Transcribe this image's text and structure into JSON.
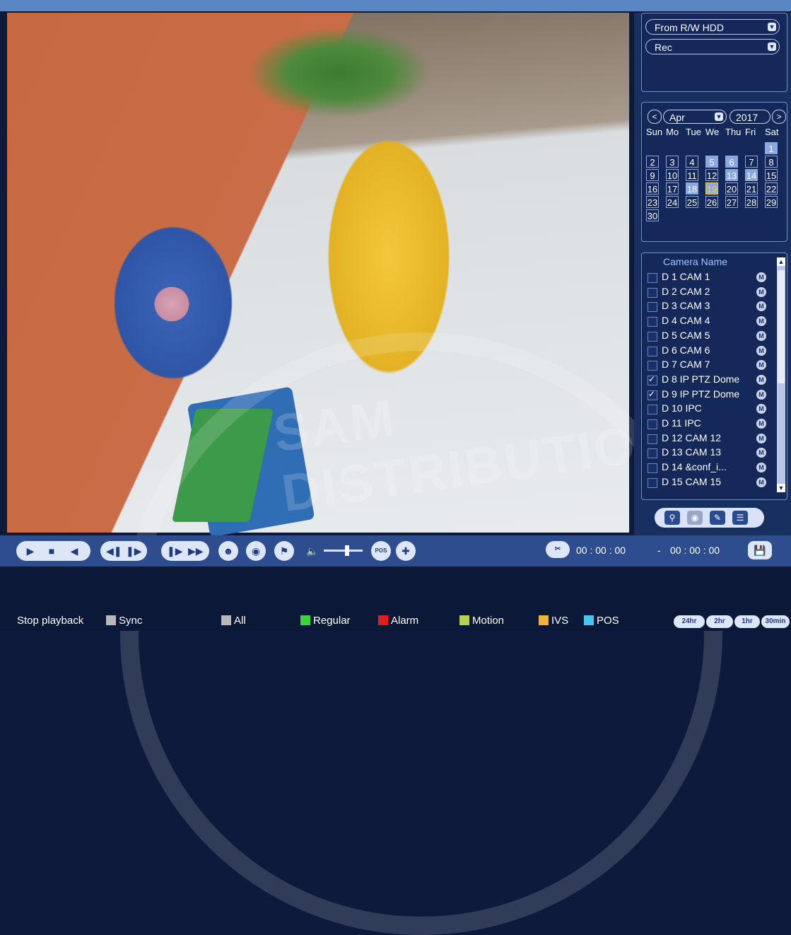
{
  "video": {
    "watermark": "SAM DISTRIBUTION"
  },
  "source": {
    "device": "From R/W HDD",
    "type": "Rec"
  },
  "calendar": {
    "month": "Apr",
    "year": "2017",
    "weekdays": [
      "Sun",
      "Mo",
      "Tue",
      "We",
      "Thu",
      "Fri",
      "Sat"
    ],
    "days": [
      {
        "d": "1",
        "col": 6,
        "row": 0,
        "rec": true
      },
      {
        "d": "2",
        "col": 0,
        "row": 1
      },
      {
        "d": "3",
        "col": 1,
        "row": 1
      },
      {
        "d": "4",
        "col": 2,
        "row": 1
      },
      {
        "d": "5",
        "col": 3,
        "row": 1,
        "rec": true
      },
      {
        "d": "6",
        "col": 4,
        "row": 1,
        "rec": true
      },
      {
        "d": "7",
        "col": 5,
        "row": 1
      },
      {
        "d": "8",
        "col": 6,
        "row": 1
      },
      {
        "d": "9",
        "col": 0,
        "row": 2
      },
      {
        "d": "10",
        "col": 1,
        "row": 2
      },
      {
        "d": "11",
        "col": 2,
        "row": 2
      },
      {
        "d": "12",
        "col": 3,
        "row": 2
      },
      {
        "d": "13",
        "col": 4,
        "row": 2,
        "rec": true
      },
      {
        "d": "14",
        "col": 5,
        "row": 2,
        "rec": true
      },
      {
        "d": "15",
        "col": 6,
        "row": 2
      },
      {
        "d": "16",
        "col": 0,
        "row": 3
      },
      {
        "d": "17",
        "col": 1,
        "row": 3
      },
      {
        "d": "18",
        "col": 2,
        "row": 3,
        "rec": true
      },
      {
        "d": "19",
        "col": 3,
        "row": 3,
        "today": true
      },
      {
        "d": "20",
        "col": 4,
        "row": 3
      },
      {
        "d": "21",
        "col": 5,
        "row": 3
      },
      {
        "d": "22",
        "col": 6,
        "row": 3
      },
      {
        "d": "23",
        "col": 0,
        "row": 4
      },
      {
        "d": "24",
        "col": 1,
        "row": 4
      },
      {
        "d": "25",
        "col": 2,
        "row": 4
      },
      {
        "d": "26",
        "col": 3,
        "row": 4
      },
      {
        "d": "27",
        "col": 4,
        "row": 4
      },
      {
        "d": "28",
        "col": 5,
        "row": 4
      },
      {
        "d": "29",
        "col": 6,
        "row": 4
      },
      {
        "d": "30",
        "col": 0,
        "row": 5
      }
    ]
  },
  "cameras": {
    "header": "Camera Name",
    "mode_label": "M",
    "list": [
      {
        "name": "D 1 CAM 1",
        "checked": false
      },
      {
        "name": "D 2 CAM 2",
        "checked": false
      },
      {
        "name": "D 3 CAM 3",
        "checked": false
      },
      {
        "name": "D 4 CAM 4",
        "checked": false
      },
      {
        "name": "D 5 CAM 5",
        "checked": false
      },
      {
        "name": "D 6 CAM 6",
        "checked": false
      },
      {
        "name": "D 7 CAM 7",
        "checked": false
      },
      {
        "name": "D 8 IP PTZ Dome",
        "checked": true
      },
      {
        "name": "D 9 IP PTZ Dome",
        "checked": true
      },
      {
        "name": "D 10 IPC",
        "checked": false
      },
      {
        "name": "D 11 IPC",
        "checked": false
      },
      {
        "name": "D 12 CAM 12",
        "checked": false
      },
      {
        "name": "D 13 CAM 13",
        "checked": false
      },
      {
        "name": "D 14 &conf_i...",
        "checked": false
      },
      {
        "name": "D 15 CAM 15",
        "checked": false
      }
    ]
  },
  "controls": {
    "start_time": "00 : 00 : 00",
    "separator": "-",
    "end_time": "00 : 00 : 00",
    "pos_label": "POS"
  },
  "bottom": {
    "stop_label": "Stop playback",
    "sync_label": "Sync",
    "filters": [
      {
        "label": "All",
        "color": "#b8b8b8"
      },
      {
        "label": "Regular",
        "color": "#3bd23b"
      },
      {
        "label": "Alarm",
        "color": "#e21d1d"
      },
      {
        "label": "Motion",
        "color": "#b6d24c"
      },
      {
        "label": "IVS",
        "color": "#f0b43a"
      },
      {
        "label": "POS",
        "color": "#49c6f0"
      }
    ],
    "zoom": [
      "24hr",
      "2hr",
      "1hr",
      "30min"
    ]
  }
}
